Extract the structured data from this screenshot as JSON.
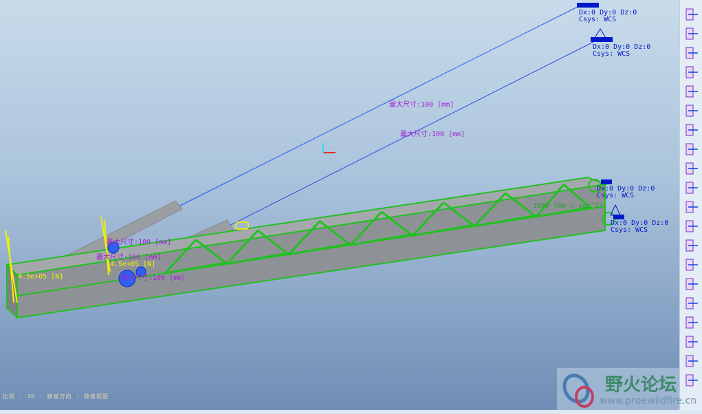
{
  "viewport": {
    "constraints": [
      {
        "line1": "Dx:0 Dy:0 Dz:0",
        "line2": "Csys: WCS"
      },
      {
        "line1": "Dx:0 Dy:0 Dz:0",
        "line2": "Csys: WCS"
      },
      {
        "line1": "Dx:0 Dy:0 Dz:0",
        "line2": "Csys: WCS"
      },
      {
        "line1": "Dx:0 Dy:0 Dz:0",
        "line2": "Csys: WCS"
      }
    ],
    "dimensions": [
      "最大尺寸:100 [mm]",
      "最大尺寸:100 [mm]",
      "最大尺寸:100 [mm]",
      "最大尺寸:100 [mm]",
      "最大尺寸:100 [mm]"
    ],
    "loads": [
      "4.5e+05 [N]",
      "4.5e+05 [N]"
    ],
    "acceleration": "1000 [mm / sec^2]",
    "colors": {
      "mesh": "#22c022",
      "beam": "#9a9ea2",
      "constraint": "#0018c8",
      "dimension": "#a020d0",
      "load": "#f0f000"
    }
  },
  "status": "比例 : 3D : 缺省方向 : 缺省视图",
  "toolbar": {
    "icons": [
      "displacement-constraint-icon",
      "multi-constraint-icon",
      "pin-constraint-icon",
      "force-load-icon",
      "moment-load-icon",
      "temperature-load-icon",
      "bearing-load-icon",
      "pressure-load-icon",
      "gravity-load-icon",
      "surface-region-icon",
      "volume-region-icon",
      "beam-icon",
      "spring-icon",
      "mass-icon",
      "shell-icon",
      "weld-icon",
      "rigid-link-icon",
      "measure-icon",
      "connection-icon",
      "tag-icon"
    ]
  },
  "watermark": {
    "title": "野火论坛",
    "url": "www.proewildfire.cn"
  }
}
